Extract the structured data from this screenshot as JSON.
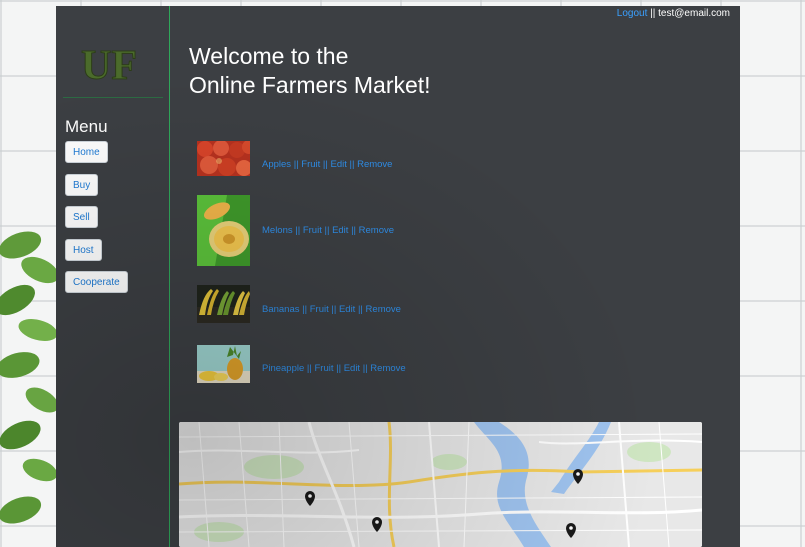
{
  "header": {
    "logout_label": "Logout",
    "separator": " || ",
    "user_email": "test@email.com"
  },
  "logo": {
    "text": "UF"
  },
  "sidebar": {
    "menu_title": "Menu",
    "items": [
      {
        "label": "Home"
      },
      {
        "label": "Buy"
      },
      {
        "label": "Sell"
      },
      {
        "label": "Host"
      },
      {
        "label": "Cooperate"
      }
    ]
  },
  "main": {
    "title_line1": "Welcome to the",
    "title_line2": "Online Farmers Market!"
  },
  "products": [
    {
      "name": "Apples",
      "category": "Fruit",
      "edit_label": "Edit",
      "remove_label": "Remove"
    },
    {
      "name": "Melons",
      "category": "Fruit",
      "edit_label": "Edit",
      "remove_label": "Remove"
    },
    {
      "name": "Bananas",
      "category": "Fruit",
      "edit_label": "Edit",
      "remove_label": "Remove"
    },
    {
      "name": "Pineapple",
      "category": "Fruit",
      "edit_label": "Edit",
      "remove_label": "Remove"
    }
  ],
  "separator": " || ",
  "colors": {
    "panel": "#3c3f43",
    "link": "#2f8ee8",
    "accent_border": "#2fa85a"
  }
}
